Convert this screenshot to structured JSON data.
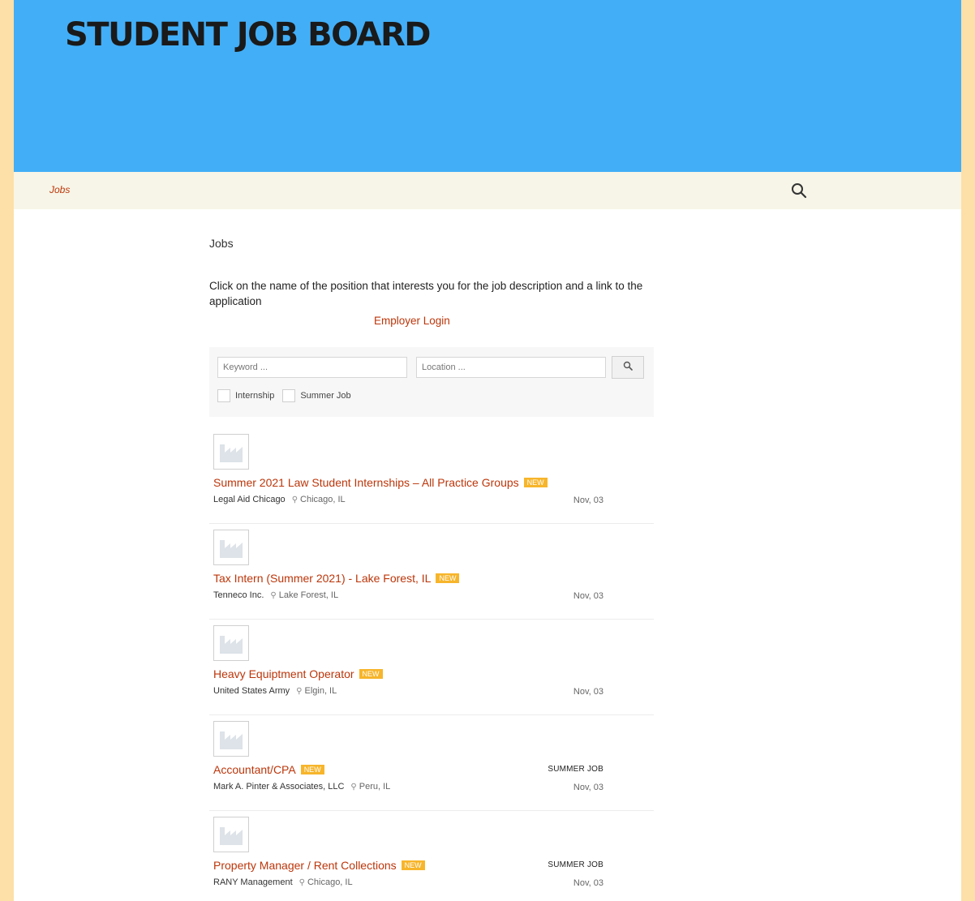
{
  "site": {
    "title": "STUDENT JOB BOARD"
  },
  "nav": {
    "jobs_label": "Jobs"
  },
  "page": {
    "heading": "Jobs",
    "intro": "Click on the name of the position that interests you for the job description and a link to the application",
    "employer_login": "Employer Login"
  },
  "filters": {
    "keyword_placeholder": "Keyword ...",
    "location_placeholder": "Location ...",
    "internship_label": "Internship",
    "summer_job_label": "Summer Job"
  },
  "jobs": [
    {
      "title": "Summer 2021 Law Student Internships – All Practice Groups",
      "badge": "NEW",
      "company": "Legal Aid Chicago",
      "location": "Chicago, IL",
      "type": "",
      "date": "Nov, 03"
    },
    {
      "title": "Tax Intern (Summer 2021) - Lake Forest, IL",
      "badge": "NEW",
      "company": "Tenneco Inc.",
      "location": "Lake Forest, IL",
      "type": "",
      "date": "Nov, 03"
    },
    {
      "title": "Heavy Equiptment Operator",
      "badge": "NEW",
      "company": "United States Army",
      "location": "Elgin, IL",
      "type": "",
      "date": "Nov, 03"
    },
    {
      "title": "Accountant/CPA",
      "badge": "NEW",
      "company": "Mark A. Pinter & Associates, LLC",
      "location": "Peru, IL",
      "type": "SUMMER JOB",
      "date": "Nov, 03"
    },
    {
      "title": "Property Manager / Rent Collections",
      "badge": "NEW",
      "company": "RANY Management",
      "location": "Chicago, IL",
      "type": "SUMMER JOB",
      "date": "Nov, 03"
    }
  ],
  "colors": {
    "header_bg": "#42aef7",
    "nav_bg": "#f7f5e7",
    "link": "#bc360a",
    "badge": "#f7b52b",
    "frame": "#fde0a8"
  }
}
